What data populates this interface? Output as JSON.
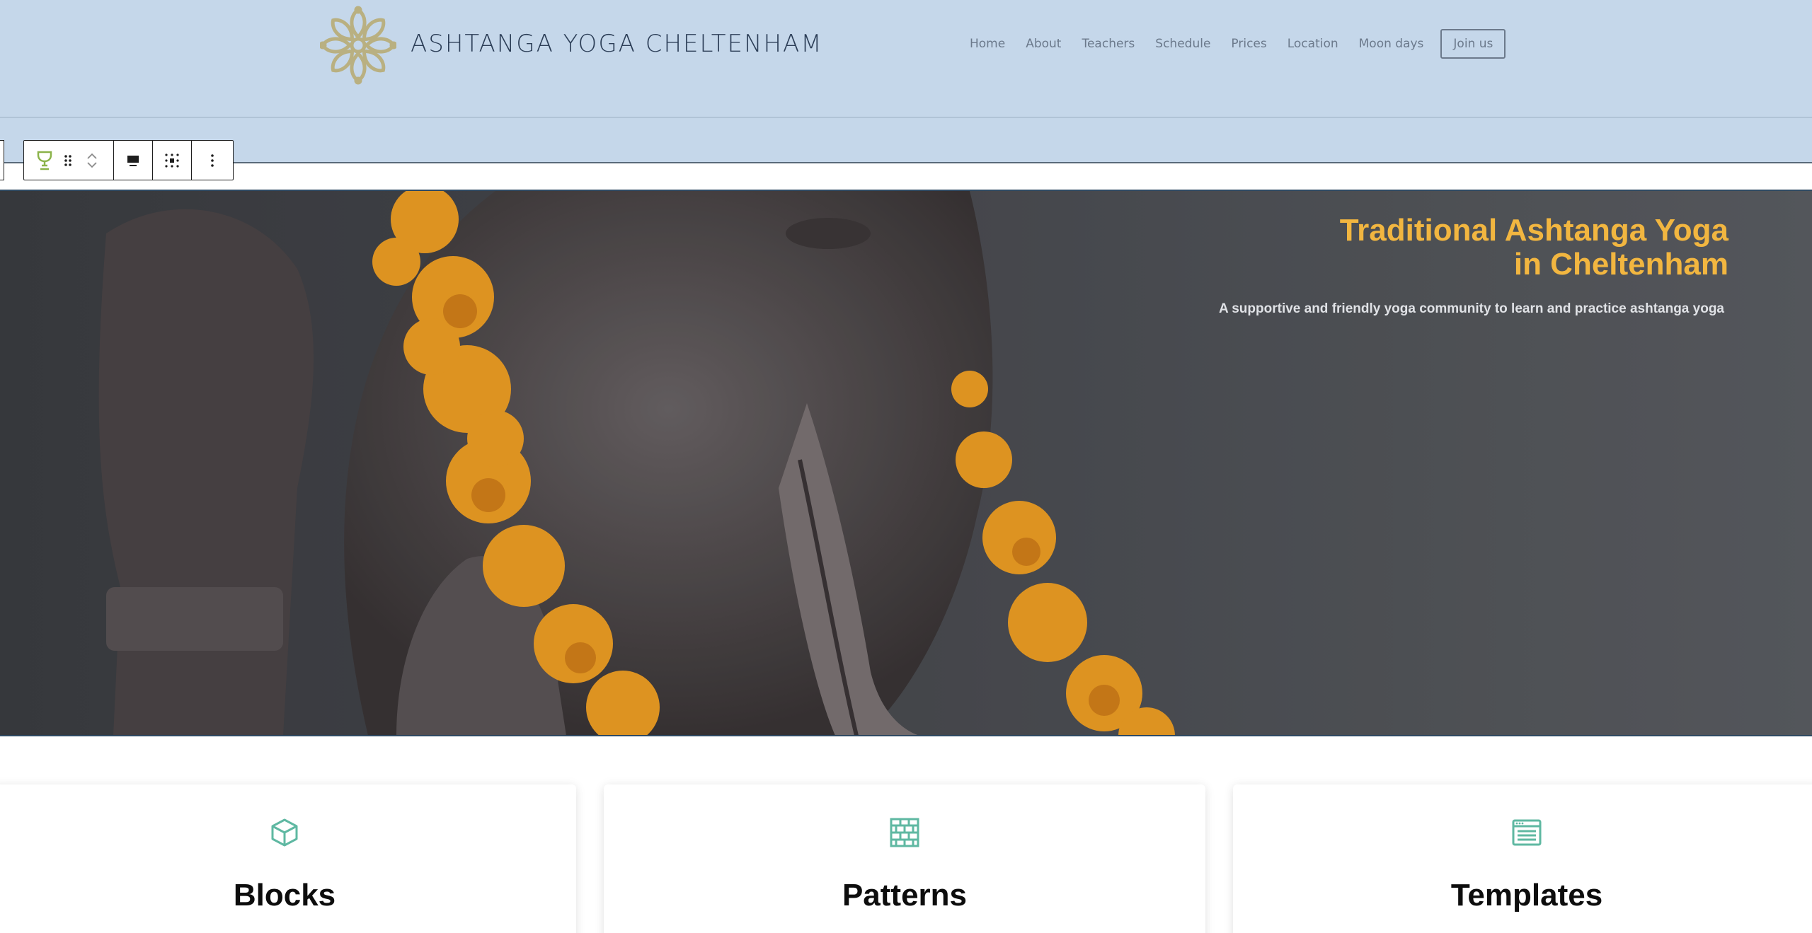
{
  "site": {
    "title": "ASHTANGA YOGA CHELTENHAM"
  },
  "nav": {
    "items": [
      {
        "label": "Home"
      },
      {
        "label": "About"
      },
      {
        "label": "Teachers"
      },
      {
        "label": "Schedule"
      },
      {
        "label": "Prices"
      },
      {
        "label": "Location"
      },
      {
        "label": "Moon days"
      }
    ],
    "cta_label": "Join us"
  },
  "toolbar": {
    "icons": [
      "cover-block-icon",
      "drag-handle-icon",
      "move-up-icon",
      "move-down-icon",
      "align-icon",
      "matrix-alignment-icon",
      "more-options-icon"
    ]
  },
  "hero": {
    "heading_line1": "Traditional Ashtanga Yoga",
    "heading_line2": "in Cheltenham",
    "subtitle": "A supportive and friendly yoga community to learn and practice ashtanga yoga"
  },
  "cards": [
    {
      "title": "Blocks",
      "icon": "cube-icon"
    },
    {
      "title": "Patterns",
      "icon": "brick-wall-icon"
    },
    {
      "title": "Templates",
      "icon": "browser-template-icon"
    }
  ],
  "colors": {
    "header_bg": "#c5d7ea",
    "hero_heading": "#f2b640",
    "card_icon": "#5fb8a2",
    "logo": "#b9b081"
  }
}
